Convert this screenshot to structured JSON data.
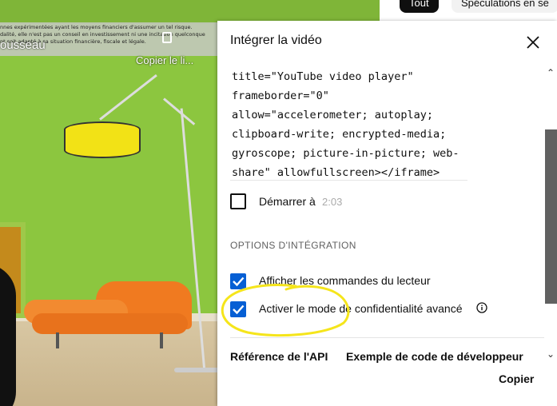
{
  "video": {
    "ticker_lines": [
      "nnes expérimentées ayant les moyens financiers d'assumer un tel risque.",
      "dalité, elle n'est pas un conseil en investissement ni une incitation quelconque",
      "nt soit adapté à sa situation financière, fiscale et légale."
    ],
    "title": "ousseau",
    "copy_link_label": "Copier le li..."
  },
  "chips": {
    "all": "Tout",
    "speculation": "Spéculations en se"
  },
  "dialog": {
    "title": "Intégrer la vidéo",
    "code_lines": [
      "title=\"YouTube video player\"",
      "frameborder=\"0\"",
      "allow=\"accelerometer; autoplay;",
      "clipboard-write; encrypted-media;",
      "gyroscope; picture-in-picture; web-",
      "share\" allowfullscreen></iframe>"
    ],
    "start_label": "Démarrer à",
    "start_time": "2:03",
    "options_heading": "OPTIONS D'INTÉGRATION",
    "options": [
      {
        "label": "Afficher les commandes du lecteur",
        "checked": true
      },
      {
        "label": "Activer le mode de confidentialité avancé",
        "checked": true
      }
    ],
    "api_link": "Référence de l'API",
    "dev_link": "Exemple de code de développeur",
    "copy_button": "Copier"
  },
  "colors": {
    "checkbox_accent": "#065fd4",
    "annotation": "#f5e51b"
  },
  "icons": {
    "close": "close-icon",
    "info": "info-icon",
    "copy": "copy-icon"
  }
}
